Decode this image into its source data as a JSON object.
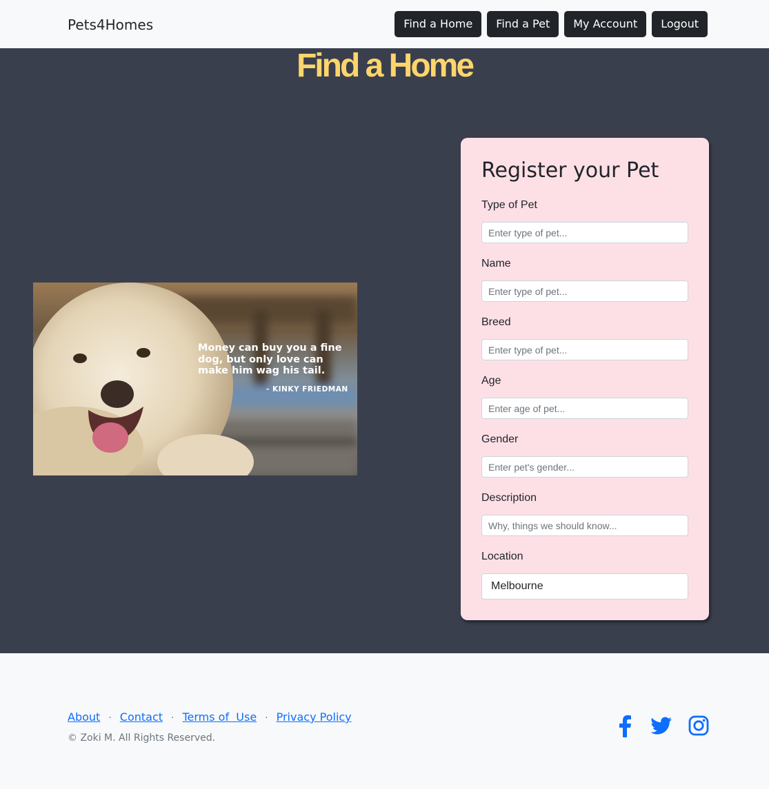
{
  "navbar": {
    "brand": "Pets4Homes",
    "buttons": [
      "Find a Home",
      "Find a Pet",
      "My Account",
      "Logout"
    ]
  },
  "hero": {
    "title": "Find a Home"
  },
  "photo": {
    "quote": "Money can buy you a fine dog, but only love can make him wag his tail.",
    "author": "- KINKY FRIEDMAN"
  },
  "form": {
    "title": "Register your Pet",
    "fields": [
      {
        "label": "Type of Pet",
        "placeholder": "Enter type of pet...",
        "value": ""
      },
      {
        "label": "Name",
        "placeholder": "Enter type of pet...",
        "value": ""
      },
      {
        "label": "Breed",
        "placeholder": "Enter type of pet...",
        "value": ""
      },
      {
        "label": "Age",
        "placeholder": "Enter age of pet...",
        "value": ""
      },
      {
        "label": "Gender",
        "placeholder": "Enter pet's gender...",
        "value": ""
      },
      {
        "label": "Description",
        "placeholder": "Why, things we should know...",
        "value": ""
      },
      {
        "label": "Location",
        "placeholder": "",
        "value": "Melbourne"
      }
    ]
  },
  "footer": {
    "links": [
      "About",
      "Contact",
      "Terms of  Use",
      "Privacy Policy"
    ],
    "separator": "·",
    "copyright": "© Zoki M. All Rights Reserved.",
    "social_icons": [
      "facebook-icon",
      "twitter-icon",
      "instagram-icon"
    ]
  },
  "colors": {
    "hero_bg": "#3a3f4e",
    "title": "#fdd56b",
    "card_bg": "#fde0e6",
    "nav_button": "#212529",
    "link": "#0d6efd"
  }
}
